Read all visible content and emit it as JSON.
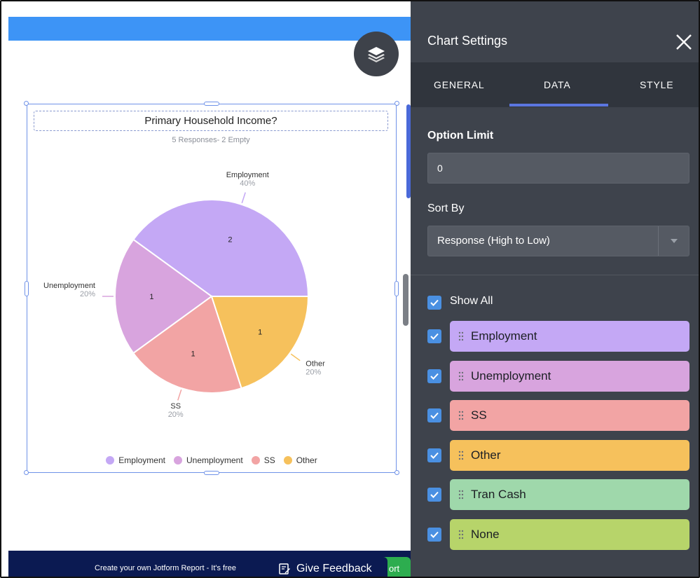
{
  "chart": {
    "title": "Primary Household Income?",
    "subtitle": "5 Responses- 2 Empty"
  },
  "chart_data": {
    "type": "pie",
    "title": "Primary Household Income?",
    "categories": [
      "Employment",
      "Unemployment",
      "SS",
      "Other"
    ],
    "values": [
      2,
      1,
      1,
      1
    ],
    "percentages": [
      "40%",
      "20%",
      "20%",
      "20%"
    ],
    "colors": [
      "#c4a8f5",
      "#d8a4de",
      "#f2a4a4",
      "#f6c15c"
    ],
    "legend_placement": "bottom"
  },
  "legend": {
    "items": [
      {
        "label": "Employment",
        "color": "#c4a8f5"
      },
      {
        "label": "Unemployment",
        "color": "#d8a4de"
      },
      {
        "label": "SS",
        "color": "#f2a4a4"
      },
      {
        "label": "Other",
        "color": "#f6c15c"
      }
    ]
  },
  "footer": {
    "promo_text": "Create your own Jotform Report - It's free",
    "feedback_label": "Give Feedback",
    "green_tail": "ort"
  },
  "panel": {
    "title": "Chart Settings",
    "tabs": [
      {
        "label": "GENERAL"
      },
      {
        "label": "DATA"
      },
      {
        "label": "STYLE"
      }
    ],
    "active_tab": "DATA",
    "option_limit_label": "Option Limit",
    "option_limit_value": "0",
    "sort_by_label": "Sort By",
    "sort_by_value": "Response (High to Low)",
    "show_all_label": "Show All",
    "options": [
      {
        "label": "Employment",
        "color": "#c4a8f5",
        "checked": true
      },
      {
        "label": "Unemployment",
        "color": "#d8a4de",
        "checked": true
      },
      {
        "label": "SS",
        "color": "#f2a4a4",
        "checked": true
      },
      {
        "label": "Other",
        "color": "#f6c15c",
        "checked": true
      },
      {
        "label": "Tran Cash",
        "color": "#9fd8ab",
        "checked": true
      },
      {
        "label": "None",
        "color": "#b7d46a",
        "checked": true
      }
    ]
  },
  "colors": {
    "accent_blue": "#3d94f6",
    "panel_bg": "#3e434c",
    "footer_bg": "#0b1a52"
  }
}
